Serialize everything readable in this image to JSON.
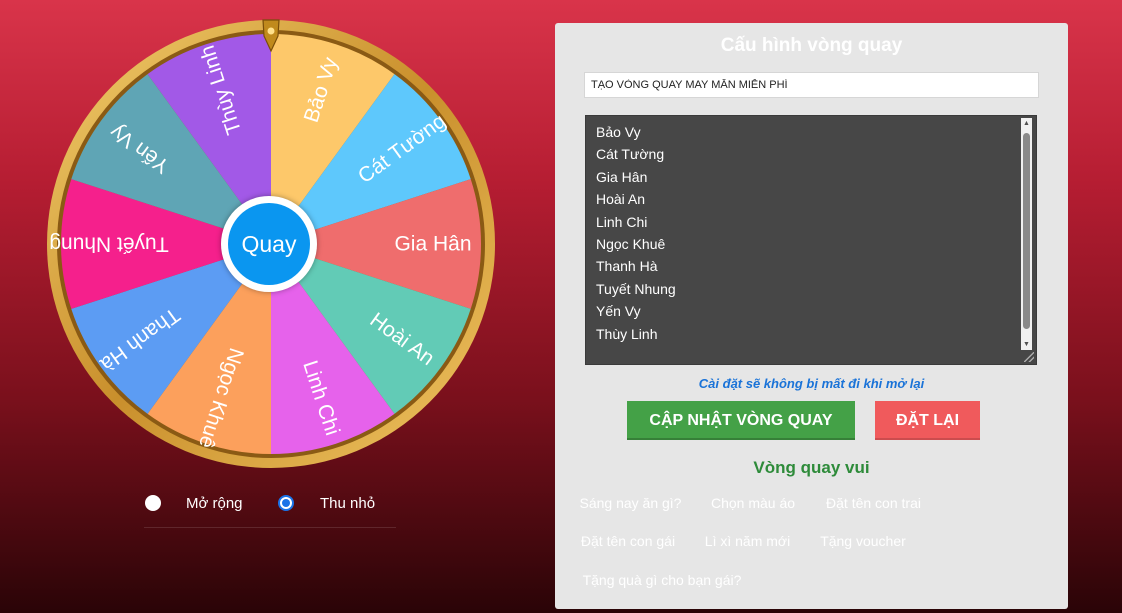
{
  "wheel": {
    "center_label": "Quay",
    "segments": [
      {
        "label": "Bảo Vy",
        "color": "#fdc86a"
      },
      {
        "label": "Cát Tường",
        "color": "#5ec8fc"
      },
      {
        "label": "Gia Hân",
        "color": "#ef6d6d"
      },
      {
        "label": "Hoài An",
        "color": "#62cbb6"
      },
      {
        "label": "Linh Chi",
        "color": "#e662eb"
      },
      {
        "label": "Ngọc Khuê",
        "color": "#fca05c"
      },
      {
        "label": "Thanh Hà",
        "color": "#5c9cf3"
      },
      {
        "label": "Tuyết Nhung",
        "color": "#f5208c"
      },
      {
        "label": "Yến Vy",
        "color": "#5fa5b5"
      },
      {
        "label": "Thùy Linh",
        "color": "#a259e7"
      }
    ],
    "rim_color": "#d7a541",
    "hub_color": "#0a96f0"
  },
  "mode": {
    "expand_label": "Mở rộng",
    "collapse_label": "Thu nhỏ",
    "selected": "Thu nhỏ"
  },
  "config": {
    "title": "Cấu hình vòng quay",
    "wheel_title_value": "TẠO VÒNG QUAY MAY MẮN MIỄN PHÍ",
    "names": [
      "Bảo Vy",
      "Cát Tường",
      "Gia Hân",
      "Hoài An",
      "Linh Chi",
      "Ngọc Khuê",
      "Thanh Hà",
      "Tuyết Nhung",
      "Yến Vy",
      "Thùy Linh"
    ],
    "note": "Cài đặt sẽ không bị mất đi khi mở lại",
    "update_button": "CẬP NHẬT VÒNG QUAY",
    "reset_button": "ĐẶT LẠI"
  },
  "fun_wheels": {
    "title": "Vòng quay vui",
    "chips": [
      {
        "label": "Sáng nay ăn gì?",
        "color": "#55a882"
      },
      {
        "label": "Chọn màu áo",
        "color": "#d4a85c"
      },
      {
        "label": "Đặt tên con trai",
        "color": "#4a8fc4"
      },
      {
        "label": "Đặt tên con gái",
        "color": "#e06c9a"
      },
      {
        "label": "Lì xì năm mới",
        "color": "#ef6b6b"
      },
      {
        "label": "Tặng voucher",
        "color": "#5cb85c"
      },
      {
        "label": "Tặng quà gì cho bạn gái?",
        "color": "#8e5bc4"
      }
    ]
  }
}
